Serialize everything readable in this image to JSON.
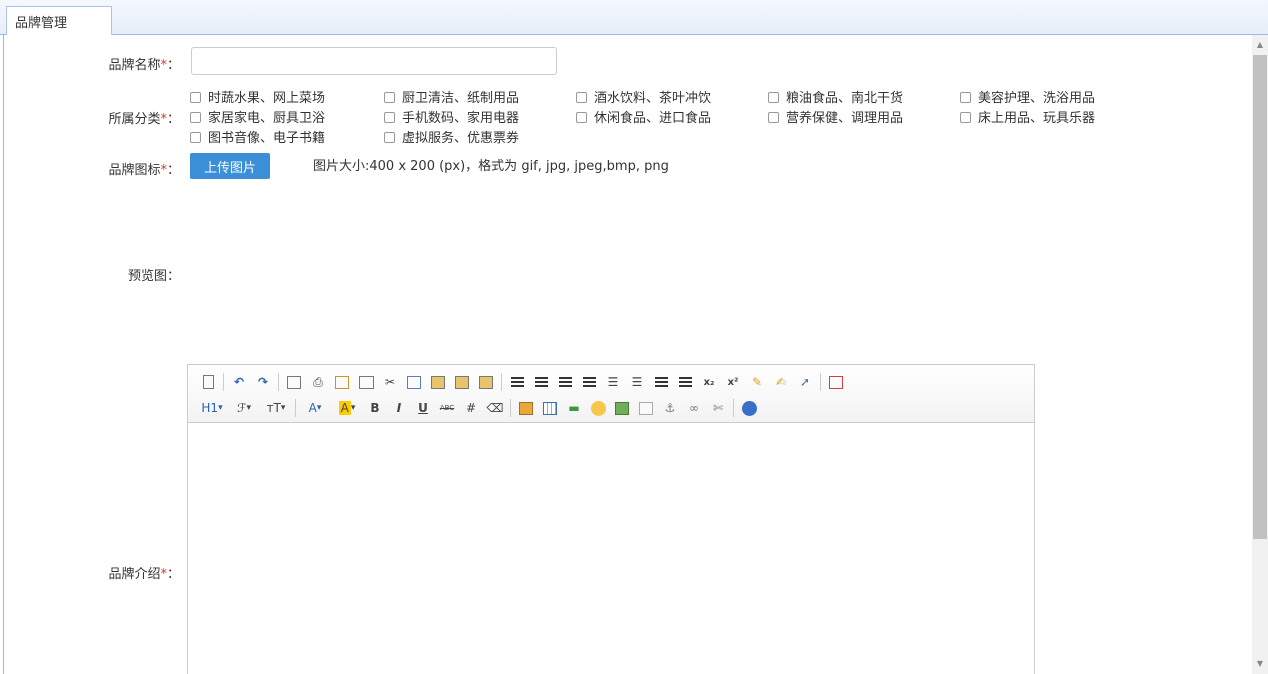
{
  "tab": {
    "label": "品牌管理"
  },
  "form": {
    "name_label": "品牌名称",
    "category_label": "所属分类",
    "icon_label": "品牌图标",
    "preview_label": "预览图",
    "intro_label": "品牌介绍",
    "required_mark": "*",
    "colon": "：",
    "name_value": "",
    "upload_button": "上传图片",
    "upload_hint": "图片大小:400 x 200 (px)，格式为 gif, jpg, jpeg,bmp, png"
  },
  "categories": [
    "时蔬水果、网上菜场",
    "厨卫清洁、纸制用品",
    "酒水饮料、茶叶冲饮",
    "粮油食品、南北干货",
    "美容护理、洗浴用品",
    "家居家电、厨具卫浴",
    "手机数码、家用电器",
    "休闲食品、进口食品",
    "营养保健、调理用品",
    "床上用品、玩具乐器",
    "图书音像、电子书籍",
    "虚拟服务、优惠票券"
  ],
  "toolbar": {
    "row1": [
      "source-icon",
      "undo-icon",
      "redo-icon",
      "preview-icon",
      "print-icon",
      "template-icon",
      "code-icon",
      "cut-icon",
      "copy-icon",
      "paste-icon",
      "paste-text-icon",
      "paste-word-icon",
      "align-left-icon",
      "align-center-icon",
      "align-right-icon",
      "align-justify-icon",
      "ordered-list-icon",
      "unordered-list-icon",
      "indent-icon",
      "outdent-icon",
      "subscript-icon",
      "superscript-icon",
      "clear-format-icon",
      "select-all-icon",
      "cursor-icon",
      "fullscreen-icon"
    ],
    "row2": [
      "heading-icon",
      "font-family-icon",
      "font-size-icon",
      "font-color-icon",
      "highlight-color-icon",
      "bold-icon",
      "italic-icon",
      "underline-icon",
      "strikethrough-icon",
      "line-height-icon",
      "remove-format-icon",
      "image-icon",
      "table-icon",
      "hr-icon",
      "emoticon-icon",
      "media-icon",
      "page-break-icon",
      "anchor-icon",
      "link-icon",
      "unlink-icon",
      "help-icon"
    ],
    "heading_text": "H1",
    "font_color_text": "A",
    "highlight_text": "A",
    "bold_text": "B",
    "italic_text": "I",
    "underline_text": "U",
    "strike_text": "ABC",
    "dropdown_arrow": "▾"
  },
  "colors": {
    "accent": "#3b8fd6",
    "required": "#e03030",
    "tab_border": "#99bbe8"
  }
}
